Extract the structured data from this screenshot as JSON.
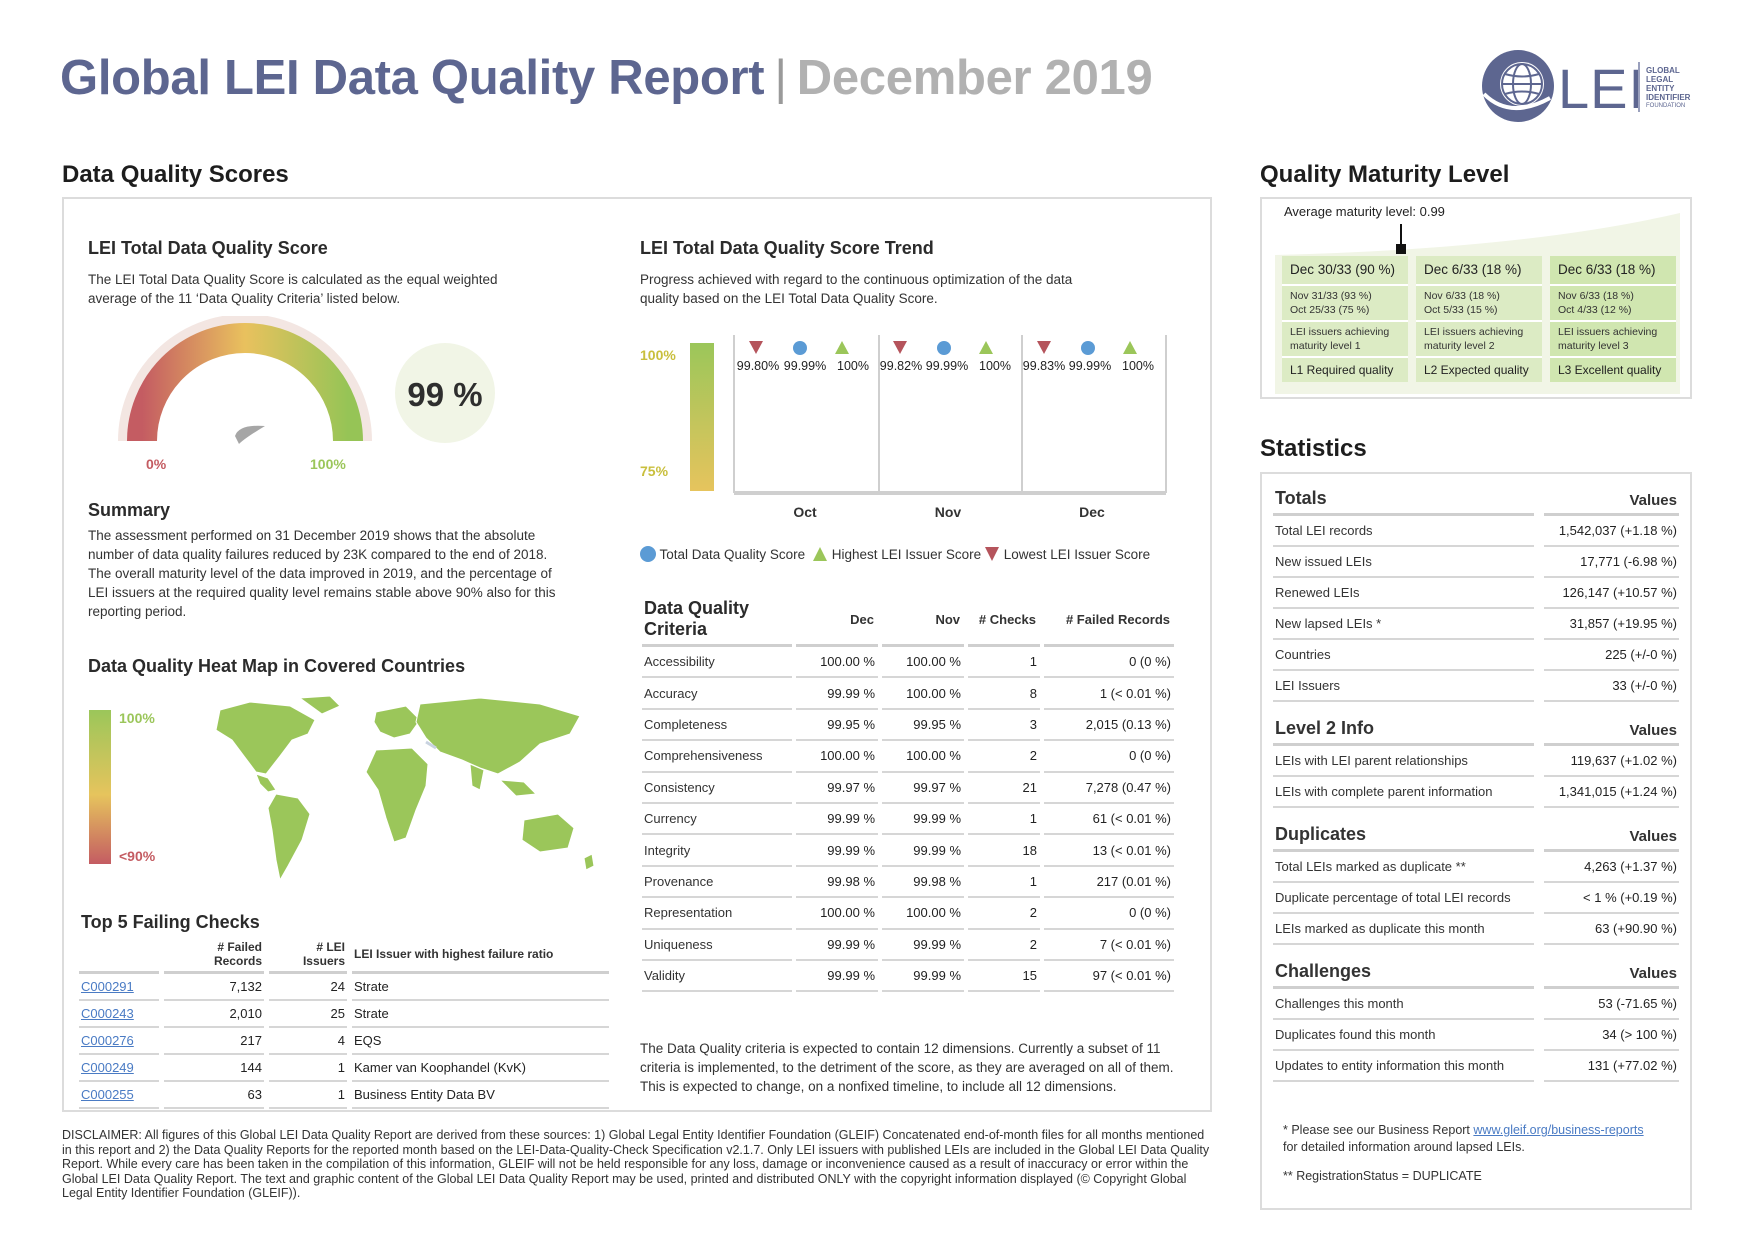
{
  "header": {
    "title": "Global LEI Data Quality Report",
    "separator": "|",
    "month": "December 2019",
    "logo_text": "LEI",
    "logo_small": [
      "GLOBAL",
      "LEGAL",
      "ENTITY",
      "IDENTIFIER",
      "FOUNDATION"
    ]
  },
  "scores": {
    "section_title": "Data Quality Scores",
    "total": {
      "title": "LEI Total Data Quality Score",
      "description": "The LEI Total Data Quality Score is calculated as the equal weighted average of the 11 ‘Data Quality Criteria’ listed below.",
      "value_text": "99 %",
      "gauge_value": 0.99,
      "gauge_min_label": "0%",
      "gauge_max_label": "100%"
    },
    "summary": {
      "title": "Summary",
      "text": "The assessment performed on 31 December 2019 shows that the absolute number of data quality failures reduced by 23K compared to the end of 2018. The overall maturity level of the data improved in 2019, and the percentage of LEI issuers at the required quality level remains stable above 90% also for this reporting period."
    },
    "heatmap": {
      "title": "Data Quality Heat Map in Covered Countries",
      "scale_top": "100%",
      "scale_bottom": "<90%"
    },
    "failing": {
      "title": "Top 5 Failing Checks",
      "headers": [
        "",
        "# Failed Records",
        "# LEI Issuers",
        "LEI Issuer with highest failure ratio"
      ],
      "rows": [
        {
          "code": "C000291",
          "failed": "7,132",
          "issuers": "24",
          "issuer": "Strate"
        },
        {
          "code": "C000243",
          "failed": "2,010",
          "issuers": "25",
          "issuer": "Strate"
        },
        {
          "code": "C000276",
          "failed": "217",
          "issuers": "4",
          "issuer": "EQS"
        },
        {
          "code": "C000249",
          "failed": "144",
          "issuers": "1",
          "issuer": "Kamer van Koophandel (KvK)"
        },
        {
          "code": "C000255",
          "failed": "63",
          "issuers": "1",
          "issuer": "Business Entity Data BV"
        }
      ]
    },
    "trend": {
      "title": "LEI Total Data Quality Score Trend",
      "description": "Progress achieved with regard to the continuous optimization of the data quality based on the LEI Total Data Quality Score.",
      "axis_top": "100%",
      "axis_bottom": "75%",
      "months": [
        {
          "label": "Oct",
          "lowest": "99.80%",
          "total": "99.99%",
          "highest": "100%"
        },
        {
          "label": "Nov",
          "lowest": "99.82%",
          "total": "99.99%",
          "highest": "100%"
        },
        {
          "label": "Dec",
          "lowest": "99.83%",
          "total": "99.99%",
          "highest": "100%"
        }
      ],
      "legend": [
        "Total Data Quality Score",
        "Highest LEI Issuer Score",
        "Lowest LEI Issuer Score"
      ],
      "colors": {
        "total": "#5b9bd5",
        "highest": "#9bc65a",
        "lowest": "#b5545c"
      }
    },
    "criteria": {
      "title": "Data Quality Criteria",
      "headers": [
        "Dec",
        "Nov",
        "# Checks",
        "# Failed Records"
      ],
      "rows": [
        {
          "name": "Accessibility",
          "dec": "100.00 %",
          "nov": "100.00 %",
          "checks": "1",
          "failed": "0 (0 %)"
        },
        {
          "name": "Accuracy",
          "dec": "99.99 %",
          "nov": "100.00 %",
          "checks": "8",
          "failed": "1 (< 0.01 %)"
        },
        {
          "name": "Completeness",
          "dec": "99.95 %",
          "nov": "99.95 %",
          "checks": "3",
          "failed": "2,015 (0.13 %)"
        },
        {
          "name": "Comprehensiveness",
          "dec": "100.00 %",
          "nov": "100.00 %",
          "checks": "2",
          "failed": "0 (0 %)"
        },
        {
          "name": "Consistency",
          "dec": "99.97 %",
          "nov": "99.97 %",
          "checks": "21",
          "failed": "7,278 (0.47 %)"
        },
        {
          "name": "Currency",
          "dec": "99.99 %",
          "nov": "99.99 %",
          "checks": "1",
          "failed": "61 (< 0.01 %)"
        },
        {
          "name": "Integrity",
          "dec": "99.99 %",
          "nov": "99.99 %",
          "checks": "18",
          "failed": "13 (< 0.01 %)"
        },
        {
          "name": "Provenance",
          "dec": "99.98 %",
          "nov": "99.98 %",
          "checks": "1",
          "failed": "217 (0.01 %)"
        },
        {
          "name": "Representation",
          "dec": "100.00 %",
          "nov": "100.00 %",
          "checks": "2",
          "failed": "0 (0 %)"
        },
        {
          "name": "Uniqueness",
          "dec": "99.99 %",
          "nov": "99.99 %",
          "checks": "2",
          "failed": "7 (< 0.01 %)"
        },
        {
          "name": "Validity",
          "dec": "99.99 %",
          "nov": "99.99 %",
          "checks": "15",
          "failed": "97 (< 0.01 %)"
        }
      ],
      "footnote": "The Data Quality criteria is expected to contain 12 dimensions. Currently a subset of 11 criteria is implemented, to the detriment of the score, as they are averaged on all of them. This is expected to change, on a nonfixed timeline, to include all 12 dimensions."
    }
  },
  "maturity": {
    "section_title": "Quality Maturity Level",
    "average": "Average maturity level: 0.99",
    "columns": [
      {
        "head": "Dec 30/33 (90 %)",
        "hist1": "Nov 31/33 (93 %)",
        "hist2": "Oct 25/33 (75 %)",
        "desc1": "LEI issuers achieving",
        "desc2": "maturity level 1",
        "level": "L1 Required quality"
      },
      {
        "head": "Dec 6/33 (18 %)",
        "hist1": "Nov 6/33 (18 %)",
        "hist2": "Oct 5/33 (15 %)",
        "desc1": "LEI issuers achieving",
        "desc2": "maturity level 2",
        "level": "L2 Expected quality"
      },
      {
        "head": "Dec 6/33 (18 %)",
        "hist1": "Nov 6/33 (18 %)",
        "hist2": "Oct 4/33 (12 %)",
        "desc1": "LEI issuers achieving",
        "desc2": "maturity level 3",
        "level": "L3 Excellent quality"
      }
    ]
  },
  "statistics": {
    "section_title": "Statistics",
    "values_label": "Values",
    "groups": [
      {
        "title": "Totals",
        "rows": [
          {
            "label": "Total LEI records",
            "value": "1,542,037 (+1.18 %)"
          },
          {
            "label": "New issued LEIs",
            "value": "17,771 (-6.98 %)"
          },
          {
            "label": "Renewed LEIs",
            "value": "126,147 (+10.57 %)"
          },
          {
            "label": "New lapsed LEIs *",
            "value": "31,857 (+19.95 %)"
          },
          {
            "label": "Countries",
            "value": "225 (+/-0 %)"
          },
          {
            "label": "LEI Issuers",
            "value": "33 (+/-0 %)"
          }
        ]
      },
      {
        "title": "Level 2 Info",
        "rows": [
          {
            "label": "LEIs with LEI parent relationships",
            "value": "119,637 (+1.02 %)"
          },
          {
            "label": "LEIs with complete parent information",
            "value": "1,341,015 (+1.24 %)"
          }
        ]
      },
      {
        "title": "Duplicates",
        "rows": [
          {
            "label": "Total LEIs marked as duplicate **",
            "value": "4,263 (+1.37 %)"
          },
          {
            "label": "Duplicate percentage of total LEI records",
            "value": "< 1 % (+0.19 %)"
          },
          {
            "label": "LEIs marked as duplicate this month",
            "value": "63 (+90.90 %)"
          }
        ]
      },
      {
        "title": "Challenges",
        "rows": [
          {
            "label": "Challenges this month",
            "value": "53 (-71.65 %)"
          },
          {
            "label": "Duplicates found this month",
            "value": "34 (> 100 %)"
          },
          {
            "label": "Updates to entity information this month",
            "value": "131 (+77.02 %)"
          }
        ]
      }
    ],
    "note1_prefix": "* Please see our Business Report ",
    "note1_link": "www.gleif.org/business-reports",
    "note1_suffix": "for detailed information around lapsed LEIs.",
    "note2": "** RegistrationStatus = DUPLICATE"
  },
  "disclaimer": "DISCLAIMER: All figures of this Global LEI Data Quality Report are derived from these sources: 1) Global Legal Entity Identifier Foundation (GLEIF) Concatenated end-of-month files for all months mentioned in this report and 2) the Data Quality Reports for the reported month based on the LEI-Data-Quality-Check Specification v2.1.7. Only LEI issuers with published LEIs are included in the Global LEI Data Quality Report. While every care has been taken in the compilation of this information, GLEIF will not be held responsible for any loss, damage or inconvenience caused as a result of inaccuracy or error within the Global LEI Data Quality Report. The text and graphic content of the Global LEI Data Quality Report may be used, printed and distributed ONLY with the copyright information displayed (© Copyright Global Legal Entity Identifier Foundation (GLEIF))."
}
